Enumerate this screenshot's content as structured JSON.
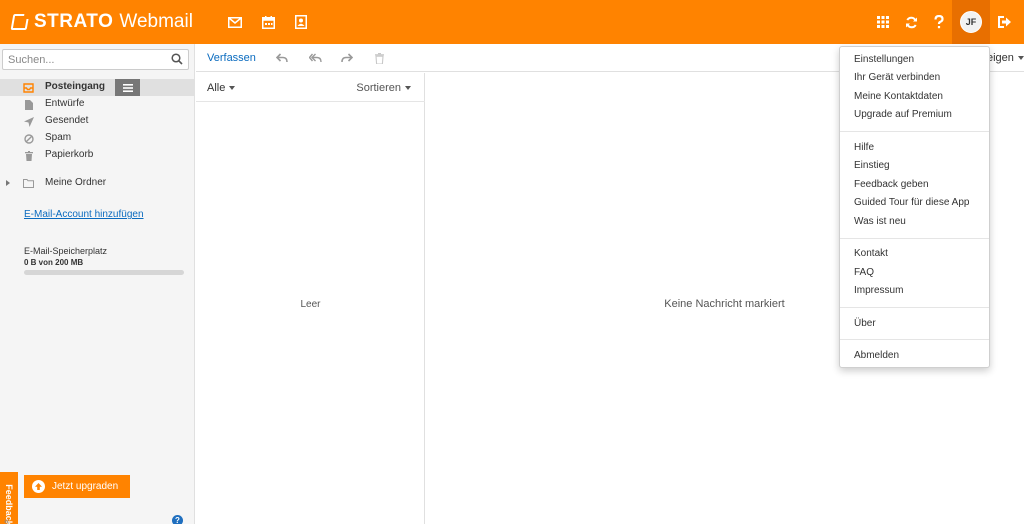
{
  "header": {
    "brand": "STRATO",
    "app_name": "Webmail",
    "app_icons": [
      "mail-icon",
      "calendar-icon",
      "contacts-icon"
    ],
    "right_icons": [
      "app-grid-icon",
      "refresh-icon",
      "help-icon"
    ],
    "avatar_initials": "JF",
    "logout_icon": "logout-icon",
    "color": "#ff8300"
  },
  "sidebar": {
    "search_placeholder": "Suchen...",
    "folders": [
      {
        "label": "Posteingang",
        "icon": "inbox-icon",
        "active": true
      },
      {
        "label": "Entwürfe",
        "icon": "draft-icon"
      },
      {
        "label": "Gesendet",
        "icon": "send-icon"
      },
      {
        "label": "Spam",
        "icon": "spam-icon"
      },
      {
        "label": "Papierkorb",
        "icon": "trash-icon"
      }
    ],
    "my_folders_label": "Meine Ordner",
    "add_account_link": "E-Mail-Account hinzufügen",
    "storage": {
      "label": "E-Mail-Speicherplatz",
      "value": "0 B von 200 MB",
      "fraction": 0
    },
    "feedback_label": "Feedback",
    "upgrade_label": "Jetzt upgraden"
  },
  "toolbar": {
    "compose_label": "Verfassen",
    "icons": [
      "reply-icon",
      "reply-all-icon",
      "forward-icon",
      "delete-icon"
    ],
    "view_label": "eigen"
  },
  "message_list": {
    "filter_label": "Alle",
    "sort_label": "Sortieren",
    "empty_label": "Leer"
  },
  "detail": {
    "empty_label": "Keine Nachricht markiert"
  },
  "user_menu": {
    "groups": [
      [
        "Einstellungen",
        "Ihr Gerät verbinden",
        "Meine Kontaktdaten",
        "Upgrade auf Premium"
      ],
      [
        "Hilfe",
        "Einstieg",
        "Feedback geben",
        "Guided Tour für diese App",
        "Was ist neu"
      ],
      [
        "Kontakt",
        "FAQ",
        "Impressum"
      ],
      [
        "Über"
      ],
      [
        "Abmelden"
      ]
    ]
  }
}
